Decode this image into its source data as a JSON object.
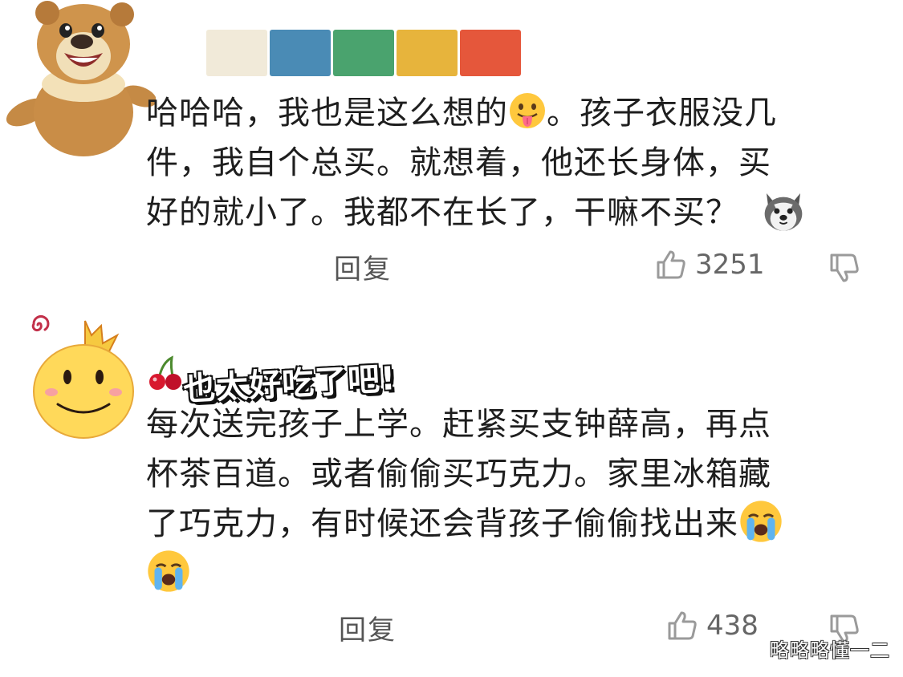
{
  "comments": [
    {
      "name_colors": [
        "#f1ead9",
        "#4a8bb5",
        "#4aa36e",
        "#e7b43c",
        "#e5573b"
      ],
      "text": {
        "line1": "哈哈哈，我也是这么想的",
        "line1_end": "。孩子衣服没几",
        "line2": "件，我自个总买。就想着，他还长身体，买",
        "line3": "好的就小了。我都不在长了，干嘛不买？"
      },
      "reply_label": "回复",
      "like_count": "3251",
      "emojis": [
        "tongue-out-emoji",
        "husky-emoji"
      ]
    },
    {
      "name_sticker": "也太好吃了吧!",
      "text": {
        "line1": "每次送完孩子上学。赶紧买支钟薛高，再点",
        "line2": "杯茶百道。或者偷偷买巧克力。家里冰箱藏",
        "line3": "了巧克力，有时候还会背孩子偷偷找出来"
      },
      "reply_label": "回复",
      "like_count": "438",
      "emojis": [
        "loudly-crying-emoji",
        "loudly-crying-emoji"
      ]
    }
  ],
  "watermark": "略略略懂一二",
  "colors": {
    "text": "#1e1e1e",
    "action": "#555555",
    "icon": "#9a9a9a"
  }
}
